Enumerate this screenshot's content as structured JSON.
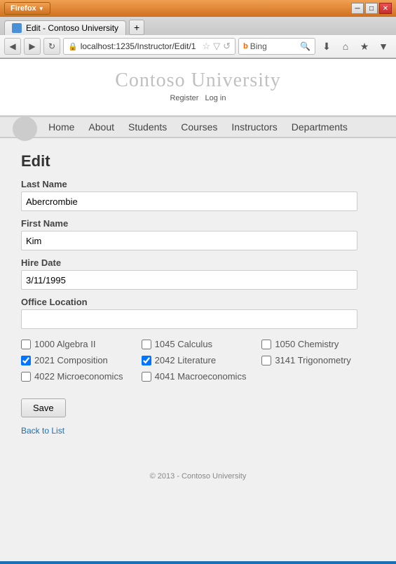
{
  "browser": {
    "firefox_label": "Firefox",
    "tab_title": "Edit - Contoso University",
    "new_tab_label": "+",
    "address": "localhost:1235/Instructor/Edit/1",
    "search_engine": "Bing",
    "search_placeholder": "Bing",
    "win_minimize": "─",
    "win_restore": "□",
    "win_close": "✕"
  },
  "header": {
    "title": "Contoso University",
    "register_label": "Register",
    "login_label": "Log in"
  },
  "nav": {
    "items": [
      {
        "label": "Home"
      },
      {
        "label": "About"
      },
      {
        "label": "Students"
      },
      {
        "label": "Courses"
      },
      {
        "label": "Instructors"
      },
      {
        "label": "Departments"
      }
    ]
  },
  "form": {
    "page_title": "Edit",
    "last_name_label": "Last Name",
    "last_name_value": "Abercrombie",
    "first_name_label": "First Name",
    "first_name_value": "Kim",
    "hire_date_label": "Hire Date",
    "hire_date_value": "3/11/1995",
    "office_location_label": "Office Location",
    "office_location_value": "",
    "save_label": "Save",
    "back_link_label": "Back to List"
  },
  "courses": [
    {
      "id": "1000",
      "label": "1000 Algebra II",
      "checked": false
    },
    {
      "id": "1045",
      "label": "1045 Calculus",
      "checked": false
    },
    {
      "id": "1050",
      "label": "1050 Chemistry",
      "checked": false
    },
    {
      "id": "2021",
      "label": "2021 Composition",
      "checked": true
    },
    {
      "id": "2042",
      "label": "2042 Literature",
      "checked": true
    },
    {
      "id": "3141",
      "label": "3141 Trigonometry",
      "checked": false
    },
    {
      "id": "4022",
      "label": "4022 Microeconomics",
      "checked": false
    },
    {
      "id": "4041",
      "label": "4041 Macroeconomics",
      "checked": false
    }
  ],
  "footer": {
    "copyright": "© 2013 - Contoso University"
  }
}
